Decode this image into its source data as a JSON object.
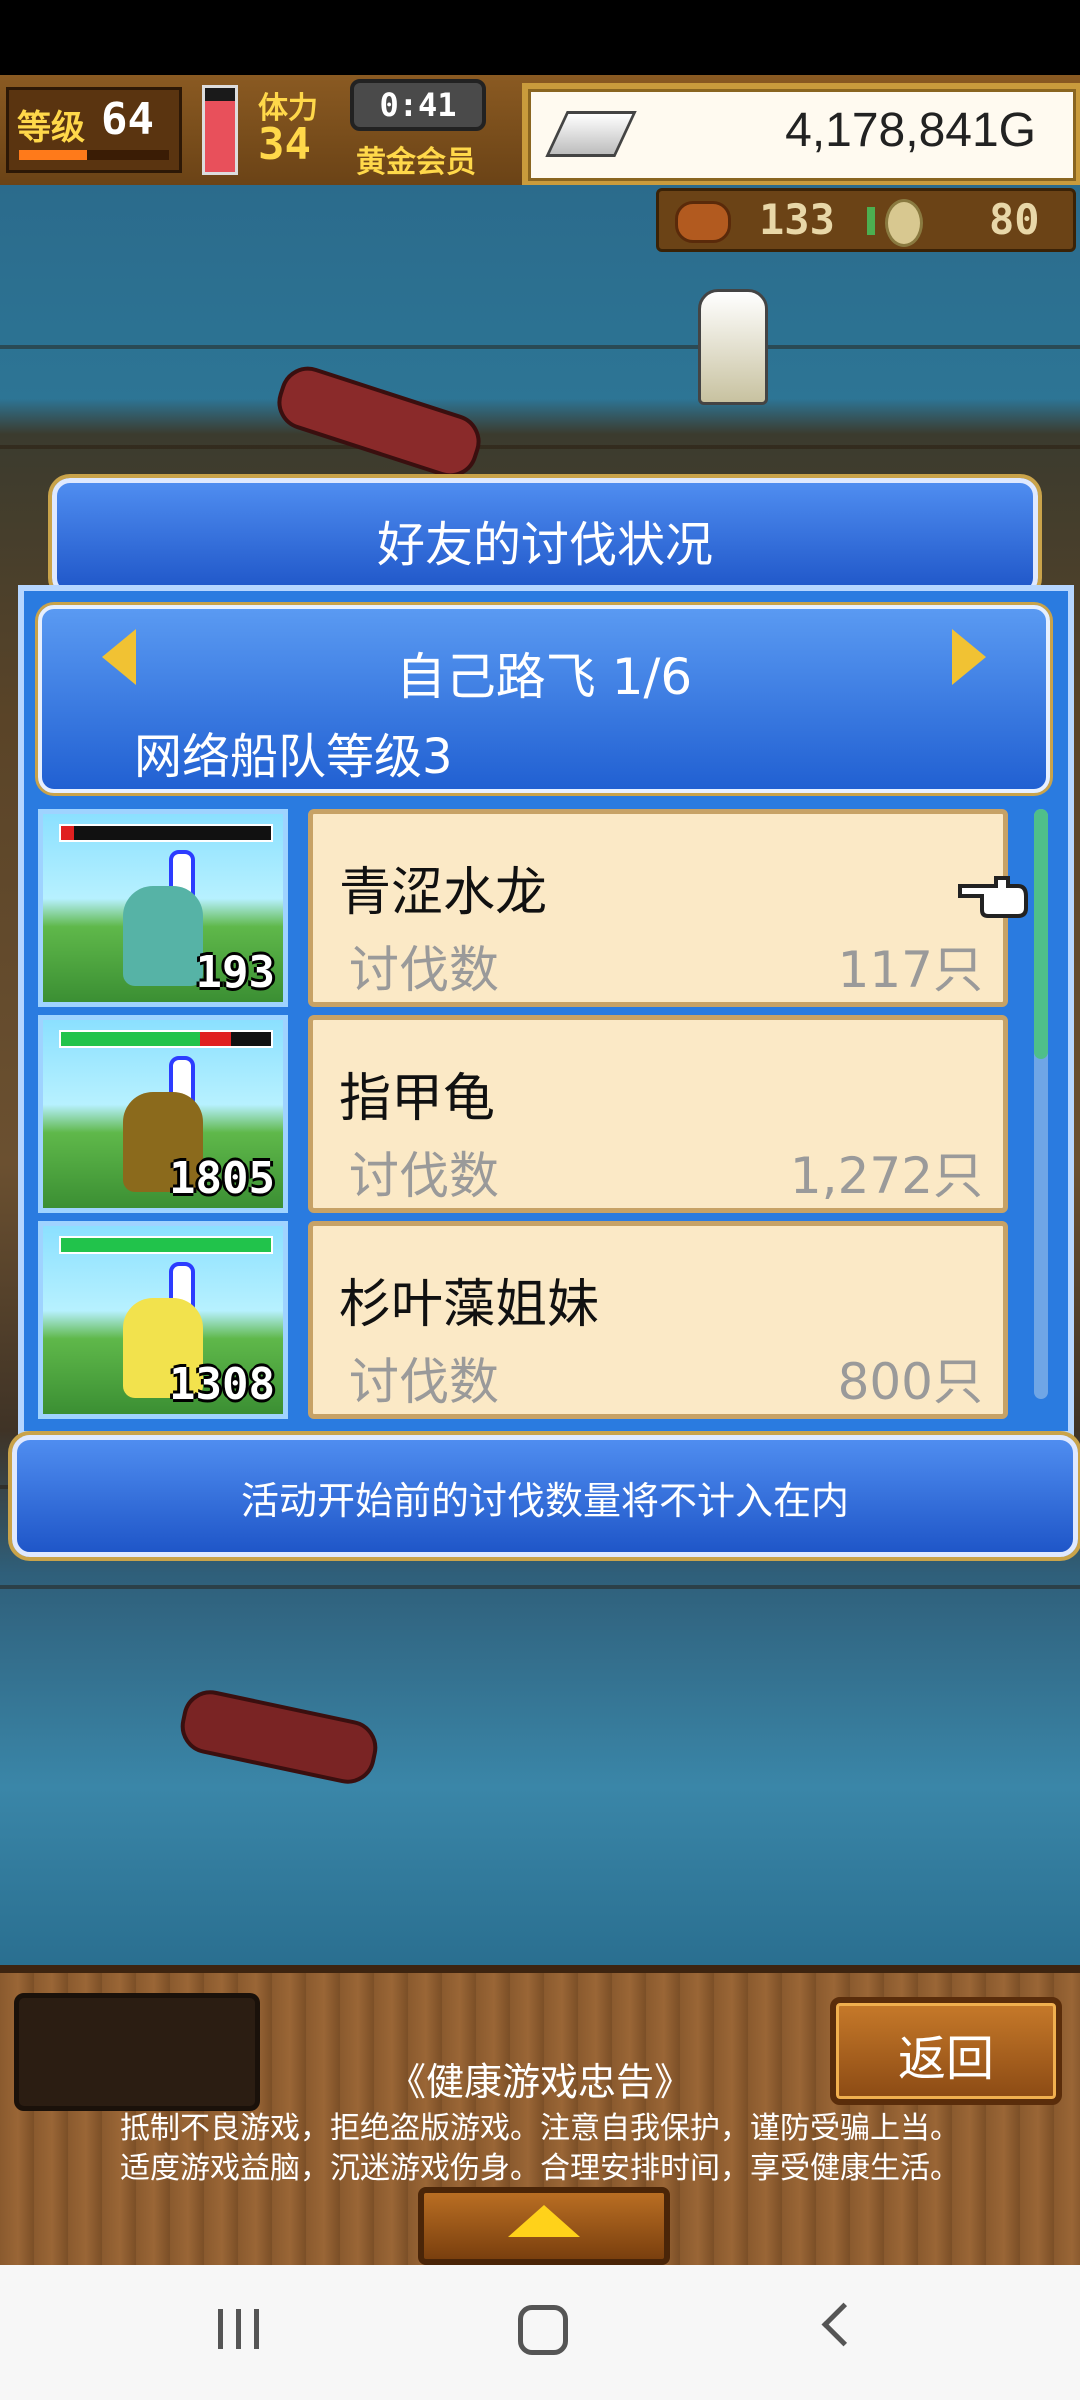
{
  "hud": {
    "level_label": "等级",
    "level_value": "64",
    "level_progress": 0.45,
    "stamina_label": "体力",
    "stamina_value": "34",
    "stamina_fill": 0.85,
    "timer": "0:41",
    "membership": "黄金会员",
    "gold": "4,178,841G",
    "meat_count": "133",
    "coin_count": "80"
  },
  "dialog": {
    "title": "好友的讨伐状况",
    "friend": "自己路飞 1/6",
    "fleet_level": "网络船队等级3",
    "prev_icon": "arrow-left-icon",
    "next_icon": "arrow-right-icon",
    "rows": [
      {
        "name": "青涩水龙",
        "label": "讨伐数",
        "value": "117只",
        "monster_level": "193",
        "hp_ratio": 0.06,
        "hp_color": "#e02020",
        "monster_color": "#56b3a6"
      },
      {
        "name": "指甲龟",
        "label": "讨伐数",
        "value": "1,272只",
        "monster_level": "1805",
        "hp_ratio": 0.66,
        "hp_color_a": "#21c34b",
        "hp_color_b": "#e02020",
        "monster_color": "#8b6a1c"
      },
      {
        "name": "杉叶藻姐妹",
        "label": "讨伐数",
        "value": "800只",
        "monster_level": "1308",
        "hp_ratio": 1.0,
        "hp_color": "#21c34b",
        "monster_color": "#f2e24d"
      }
    ],
    "notice": "活动开始前的讨伐数量将不计入在内",
    "scroll_position": 0.0
  },
  "bottom": {
    "back_label": "返回",
    "advice_title": "《健康游戏忠告》",
    "advice_line1": "抵制不良游戏，拒绝盗版游戏。注意自我保护，谨防受骗上当。",
    "advice_line2": "适度游戏益脑，沉迷游戏伤身。合理安排时间，享受健康生活。",
    "expand_icon": "triangle-up-icon"
  },
  "navbar": {
    "icons": [
      "recents-icon",
      "home-icon",
      "back-icon"
    ]
  },
  "colors": {
    "dialog_blue": "#2a7be0",
    "card_bg": "#fbe9c6",
    "gold_accent": "#c9a34a"
  }
}
